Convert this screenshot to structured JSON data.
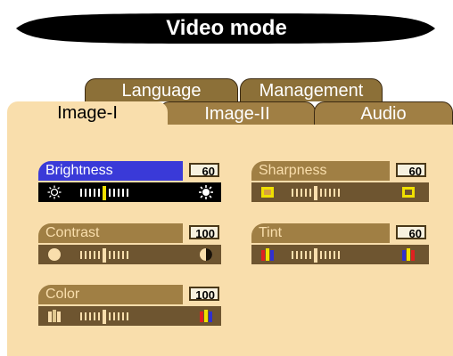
{
  "header": {
    "title": "Video mode"
  },
  "tabs": [
    {
      "label": "Language"
    },
    {
      "label": "Management"
    },
    {
      "label": "Image-I",
      "active": true
    },
    {
      "label": "Image-II"
    },
    {
      "label": "Audio"
    }
  ],
  "controls": [
    {
      "label": "Brightness",
      "value": "60",
      "selected": true,
      "left_icon": "sun-dim-icon",
      "right_icon": "sun-bright-icon"
    },
    {
      "label": "Contrast",
      "value": "100",
      "left_icon": "contrast-low-icon",
      "right_icon": "contrast-high-icon"
    },
    {
      "label": "Color",
      "value": "100",
      "left_icon": "color-low-icon",
      "right_icon": "color-high-icon"
    },
    {
      "label": "Sharpness",
      "value": "60",
      "left_icon": "sharpness-low-icon",
      "right_icon": "sharpness-high-icon"
    },
    {
      "label": "Tint",
      "value": "60",
      "left_icon": "tint-left-icon",
      "right_icon": "tint-right-icon"
    }
  ],
  "colors": {
    "panel": "#f9deac",
    "tab": "#a07f44",
    "selected": "#3a3ad8",
    "slider_cursor": "#f0e000"
  }
}
